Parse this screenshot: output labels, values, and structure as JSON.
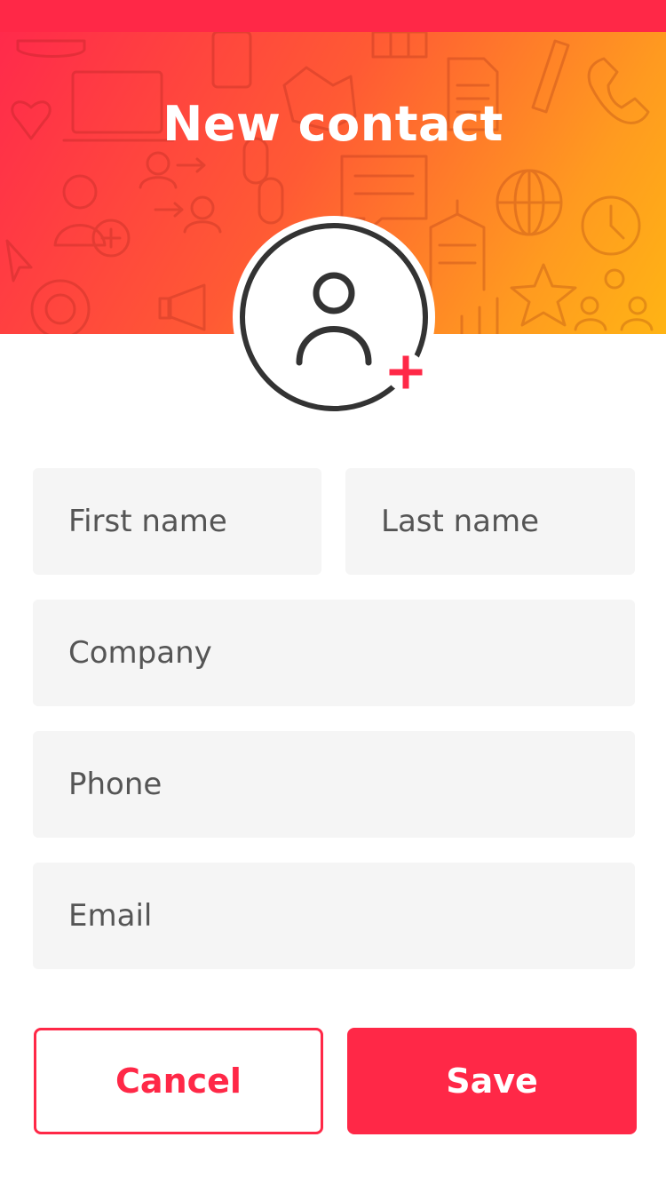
{
  "header": {
    "title": "New contact"
  },
  "avatar": {
    "icon": "person-icon",
    "badge_icon": "plus-icon"
  },
  "form": {
    "first_name": {
      "placeholder": "First name",
      "value": ""
    },
    "last_name": {
      "placeholder": "Last name",
      "value": ""
    },
    "company": {
      "placeholder": "Company",
      "value": ""
    },
    "phone": {
      "placeholder": "Phone",
      "value": ""
    },
    "email": {
      "placeholder": "Email",
      "value": ""
    }
  },
  "actions": {
    "cancel_label": "Cancel",
    "save_label": "Save"
  },
  "colors": {
    "accent": "#ff2847",
    "gradient_start": "#ff2a4b",
    "gradient_end": "#ffb414",
    "field_background": "#f5f5f5"
  }
}
